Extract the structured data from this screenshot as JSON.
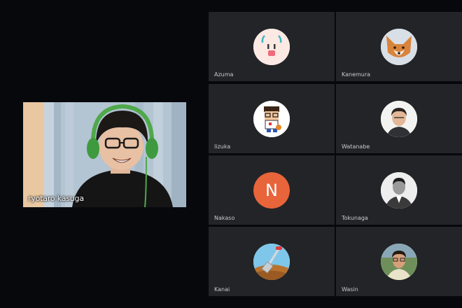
{
  "main_speaker": {
    "name": "ryotaro kasuga"
  },
  "participants": [
    {
      "name": "Azuma",
      "avatar": "ghost-character-icon"
    },
    {
      "name": "Kanemura",
      "avatar": "fox-photo"
    },
    {
      "name": "Iizuka",
      "avatar": "pixel-boy-icon"
    },
    {
      "name": "Watanabe",
      "avatar": "person-photo"
    },
    {
      "name": "Nakaso",
      "avatar": "initial-avatar",
      "initial": "N",
      "color": "#e8643a"
    },
    {
      "name": "Tokunaga",
      "avatar": "person-photo-bw"
    },
    {
      "name": "Kanai",
      "avatar": "shovel-icon"
    },
    {
      "name": "Wasin",
      "avatar": "person-photo-outdoor"
    }
  ]
}
